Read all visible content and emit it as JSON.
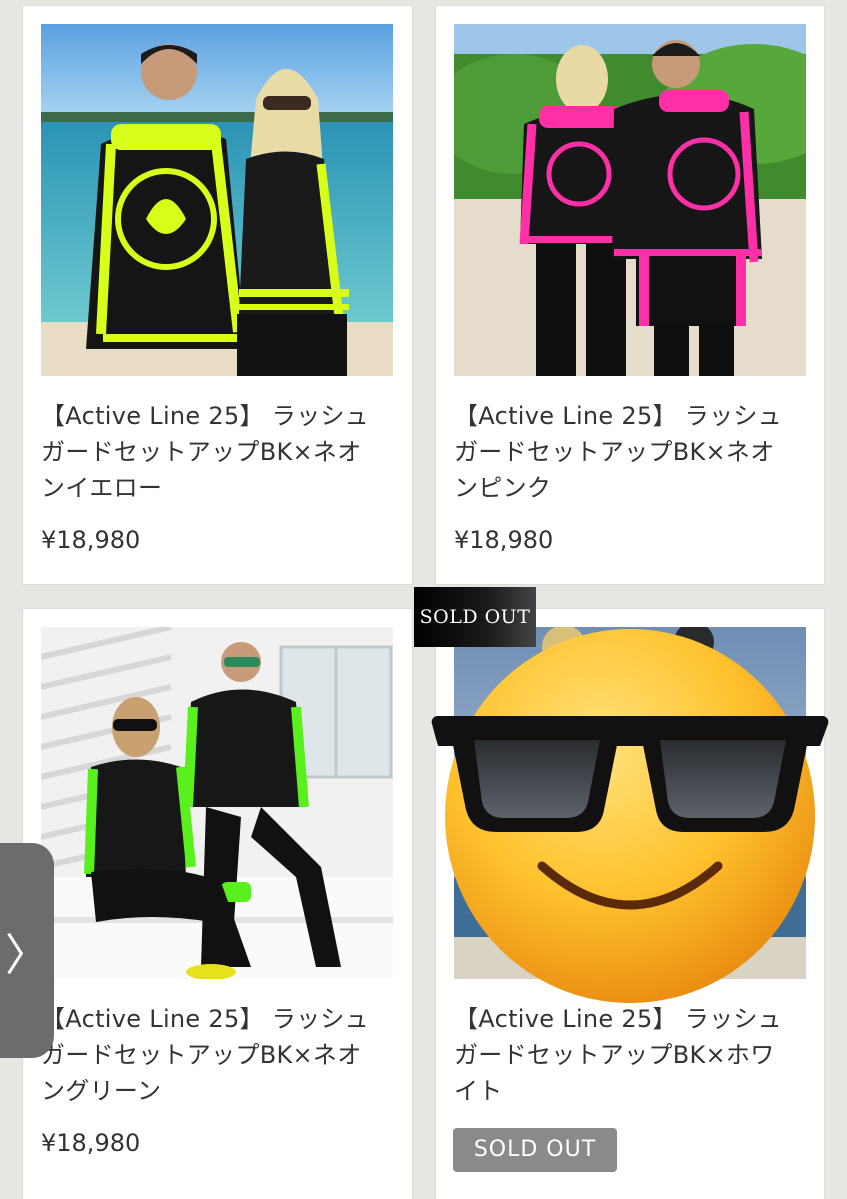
{
  "products": [
    {
      "title": "【Active Line 25】 ラッシュ\nガードセットアップBK×ネオ\nンイエロー",
      "price": "¥18,980",
      "accent": "#d8ff1a"
    },
    {
      "title": "【Active Line 25】 ラッシュ\nガードセットアップBK×ネオ\nンピンク",
      "price": "¥18,980",
      "accent": "#ff2fa8"
    },
    {
      "title": "【Active Line 25】 ラッシュ\nガードセットアップBK×ネオ\nングリーン",
      "price": "¥18,980",
      "accent": "#59f01e"
    },
    {
      "title": "【Active Line 25】 ラッシュ\nガードセットアップBK×ホワ\nイト",
      "status": "SOLD OUT",
      "accent": "#ffffff"
    }
  ],
  "sold_out_banner": "SOLD OUT",
  "side_nav": {
    "arrow": "〉",
    "icon": "chevron-right-icon"
  },
  "overlay": {
    "icon": "sunglasses-emoji-icon"
  }
}
